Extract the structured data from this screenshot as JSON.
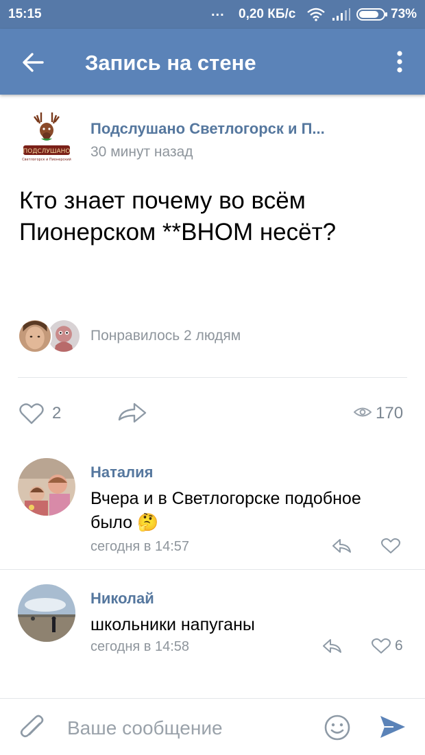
{
  "status_bar": {
    "time": "15:15",
    "dots": "...",
    "speed": "0,20 КБ/с",
    "battery": "73%"
  },
  "header": {
    "title": "Запись на стене"
  },
  "post": {
    "group_name": "Подслушано Светлогорск и П...",
    "time": "30 минут назад",
    "text": "Кто знает почему во всём Пионерском **ВНОМ несёт?",
    "likes_summary": "Понравилось 2 людям",
    "like_count": "2",
    "views": "170"
  },
  "comments": [
    {
      "author": "Наталия",
      "text": "Вчера и в Светлогорске подобное было 🤔",
      "time": "сегодня в 14:57",
      "likes": ""
    },
    {
      "author": "Николай",
      "text": "школьники напуганы",
      "time": "сегодня в 14:58",
      "likes": "6"
    }
  ],
  "composer": {
    "placeholder": "Ваше сообщение"
  },
  "colors": {
    "header": "#5b83b8",
    "status_bar": "#5679a8",
    "link": "#55779e",
    "icon_gray": "#8e9aa6",
    "send": "#5b83b8"
  }
}
